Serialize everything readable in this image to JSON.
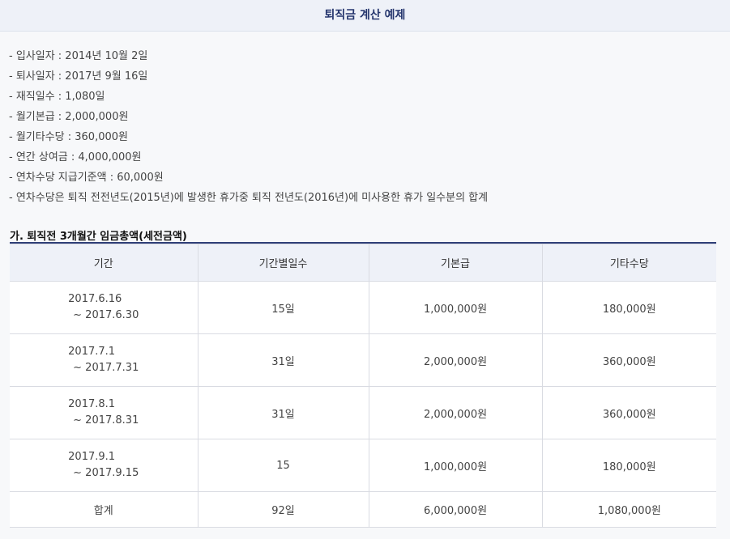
{
  "header": {
    "title": "퇴직금 계산 예제"
  },
  "info_items": [
    "- 입사일자 : 2014년 10월 2일",
    "- 퇴사일자 : 2017년 9월 16일",
    "- 재직일수 : 1,080일",
    "- 월기본급 : 2,000,000원",
    "- 월기타수당 : 360,000원",
    "- 연간 상여금 : 4,000,000원",
    "- 연차수당 지급기준액 : 60,000원",
    "- 연차수당은 퇴직 전전년도(2015년)에 발생한 휴가중 퇴직 전년도(2016년)에 미사용한 휴가 일수분의 합계"
  ],
  "section": {
    "title": "가. 퇴직전 3개월간 임금총액(세전금액)"
  },
  "table": {
    "headers": [
      "기간",
      "기간별일수",
      "기본급",
      "기타수당"
    ],
    "rows": [
      {
        "from": "2017.6.16",
        "to": "~ 2017.6.30",
        "days": "15일",
        "base": "1,000,000원",
        "extra": "180,000원"
      },
      {
        "from": "2017.7.1",
        "to": "~ 2017.7.31",
        "days": "31일",
        "base": "2,000,000원",
        "extra": "360,000원"
      },
      {
        "from": "2017.8.1",
        "to": "~ 2017.8.31",
        "days": "31일",
        "base": "2,000,000원",
        "extra": "360,000원"
      },
      {
        "from": "2017.9.1",
        "to": "~ 2017.9.15",
        "days": "15",
        "base": "1,000,000원",
        "extra": "180,000원"
      }
    ],
    "total": {
      "label": "합계",
      "days": "92일",
      "base": "6,000,000원",
      "extra": "1,080,000원"
    }
  }
}
